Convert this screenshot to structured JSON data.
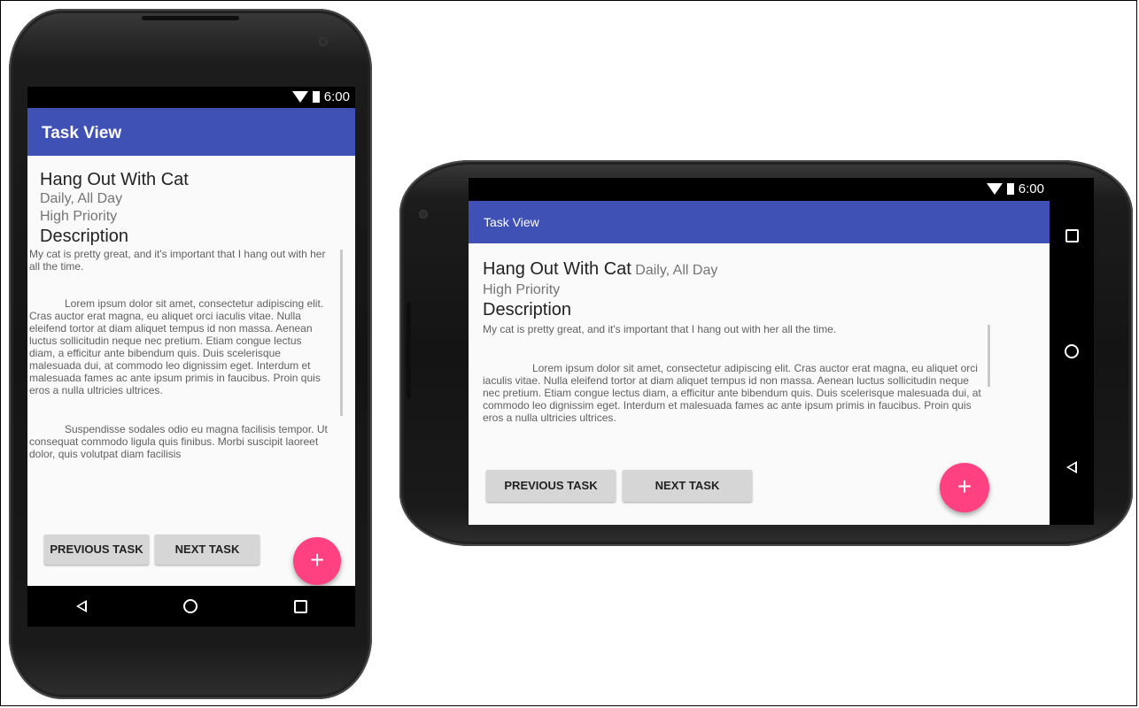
{
  "status": {
    "time": "6:00"
  },
  "appbar": {
    "title": "Task View"
  },
  "task": {
    "title": "Hang Out With Cat",
    "schedule": "Daily, All Day",
    "priority": "High Priority",
    "description_label": "Description",
    "description_text": "My cat is pretty great, and it's important that I hang out with her all the time.",
    "lorem_1": "Lorem ipsum dolor sit amet, consectetur adipiscing elit. Cras auctor erat magna, eu aliquet orci iaculis vitae. Nulla eleifend tortor at diam aliquet tempus id non massa. Aenean luctus sollicitudin neque nec pretium. Etiam congue lectus diam, a efficitur ante bibendum quis. Duis scelerisque malesuada dui, at commodo leo dignissim eget. Interdum et malesuada fames ac ante ipsum primis in faucibus. Proin quis eros a nulla ultricies ultrices.",
    "lorem_2": "Suspendisse sodales odio eu magna facilisis tempor. Ut consequat commodo ligula quis finibus. Morbi suscipit laoreet dolor, quis volutpat diam facilisis"
  },
  "buttons": {
    "previous": "PREVIOUS TASK",
    "next": "NEXT TASK",
    "fab": "+"
  },
  "colors": {
    "primary": "#3f51b5",
    "accent": "#ff4081"
  }
}
